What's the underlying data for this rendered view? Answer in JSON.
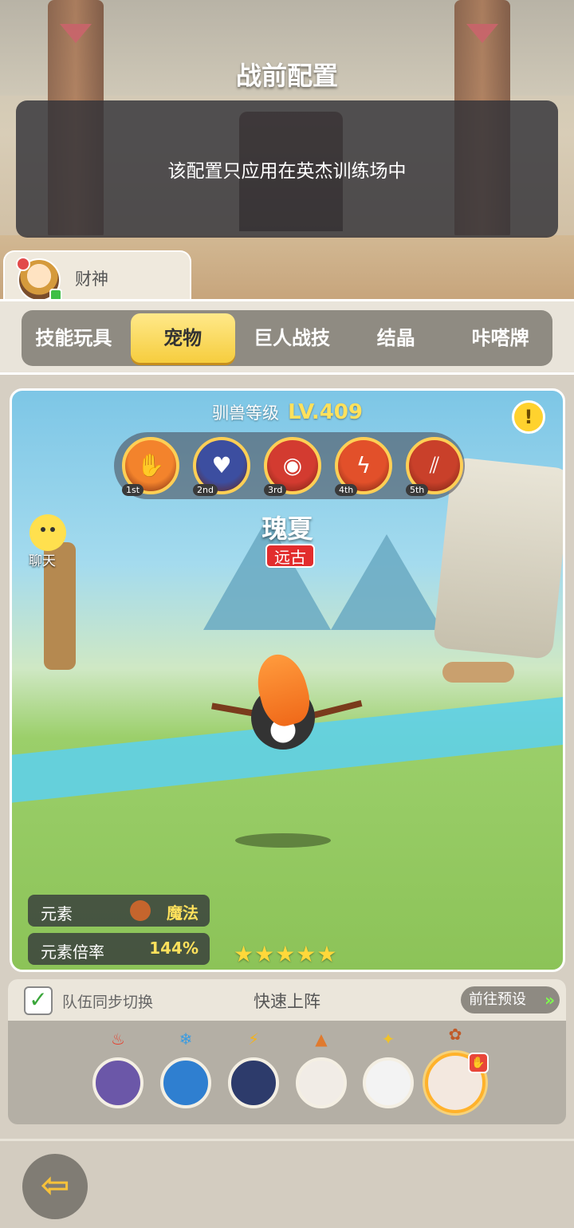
{
  "screen": {
    "title": "战前配置",
    "notice": "该配置只应用在英杰训练场中"
  },
  "user": {
    "name": "财神"
  },
  "tabs": [
    {
      "label": "技能玩具",
      "active": false
    },
    {
      "label": "宠物",
      "active": true
    },
    {
      "label": "巨人战技",
      "active": false
    },
    {
      "label": "结晶",
      "active": false
    },
    {
      "label": "咔嗒牌",
      "active": false
    }
  ],
  "pet": {
    "tamer_label": "驯兽等级",
    "tamer_level": "LV.409",
    "info_icon": "exclamation-icon",
    "skills": [
      {
        "order": "1st",
        "icon": "paw-icon",
        "color": "#f3832c"
      },
      {
        "order": "2nd",
        "icon": "heart-shield-icon",
        "color": "#3c4ea0"
      },
      {
        "order": "3rd",
        "icon": "swirl-eye-icon",
        "color": "#d33b30"
      },
      {
        "order": "4th",
        "icon": "lightning-slash-icon",
        "color": "#e2502a"
      },
      {
        "order": "5th",
        "icon": "claw-icon",
        "color": "#c9402a"
      }
    ],
    "name": "瑰夏",
    "rarity": "远古",
    "chat_label": "聊天",
    "element_label": "元素",
    "element_value": "魔法",
    "element_rate_label": "元素倍率",
    "element_rate_value": "144%",
    "stars": "★★★★★",
    "star_count": 5
  },
  "team": {
    "sync_checked": true,
    "sync_label": "队伍同步切换",
    "quick_label": "快速上阵",
    "preset_label": "前往预设",
    "preset_arrow": "»",
    "slots": [
      {
        "element_icon": "fire-icon",
        "element_glyph": "♨",
        "element_color": "#e5412f",
        "pet_color": "#6b57a8"
      },
      {
        "element_icon": "snowflake-icon",
        "element_glyph": "❄",
        "element_color": "#3a9be0",
        "pet_color": "#2f7fd0"
      },
      {
        "element_icon": "lightning-icon",
        "element_glyph": "⚡",
        "element_color": "#f3b21d",
        "pet_color": "#2d3b6b"
      },
      {
        "element_icon": "earth-icon",
        "element_glyph": "▲",
        "element_color": "#e07a2e",
        "pet_color": "#f1ece6"
      },
      {
        "element_icon": "light-icon",
        "element_glyph": "✦",
        "element_color": "#f0c22a",
        "pet_color": "#f3f3f3"
      },
      {
        "element_icon": "magic-icon",
        "element_glyph": "✿",
        "element_color": "#c05a28",
        "pet_color": "#f3e8df",
        "selected": true,
        "badge": "paw-icon"
      }
    ]
  },
  "nav": {
    "back_icon": "back-arrow-icon",
    "back_glyph": "⇦"
  }
}
